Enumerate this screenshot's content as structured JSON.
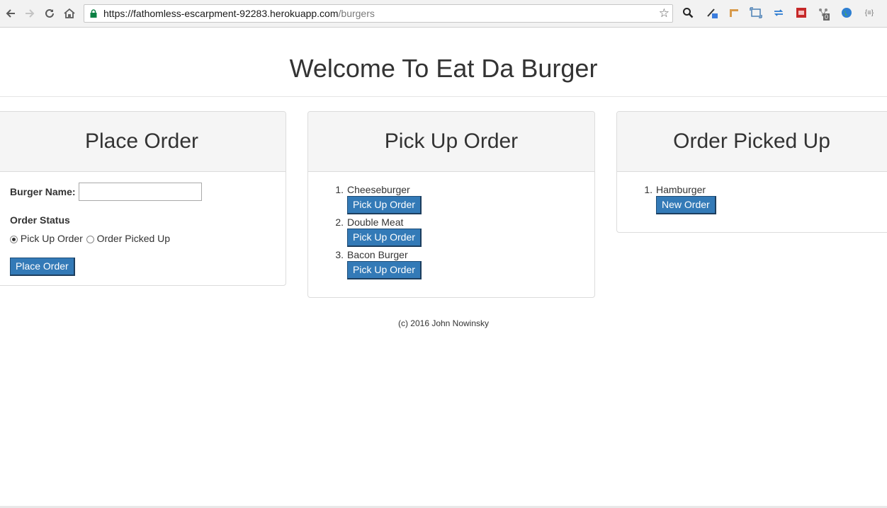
{
  "browser": {
    "url_host": "https://fathomless-escarpment-92283.herokuapp.com",
    "url_path": "/burgers",
    "back_icon": "arrow-left",
    "forward_icon": "arrow-right",
    "reload_icon": "reload",
    "home_icon": "home",
    "star_icon": "star",
    "ext_badge": "0",
    "ext_json_label": "{≡}"
  },
  "page": {
    "title": "Welcome To Eat Da Burger",
    "footer": "(c) 2016 John Nowinsky"
  },
  "place_order": {
    "heading": "Place Order",
    "burger_name_label": "Burger Name:",
    "burger_name_value": "",
    "order_status_label": "Order Status",
    "options": [
      {
        "label": "Pick Up Order",
        "checked": true
      },
      {
        "label": "Order Picked Up",
        "checked": false
      }
    ],
    "submit_label": "Place Order"
  },
  "pick_up": {
    "heading": "Pick Up Order",
    "items": [
      {
        "num": "1.",
        "name": "Cheeseburger",
        "button": "Pick Up Order"
      },
      {
        "num": "2.",
        "name": "Double Meat",
        "button": "Pick Up Order"
      },
      {
        "num": "3.",
        "name": "Bacon Burger",
        "button": "Pick Up Order"
      }
    ]
  },
  "picked_up": {
    "heading": "Order Picked Up",
    "items": [
      {
        "num": "1.",
        "name": "Hamburger",
        "button": "New Order"
      }
    ]
  },
  "colors": {
    "button_blue": "#337ab7",
    "panel_heading_bg": "#f5f5f5",
    "url_lock_green": "#0b8043"
  }
}
